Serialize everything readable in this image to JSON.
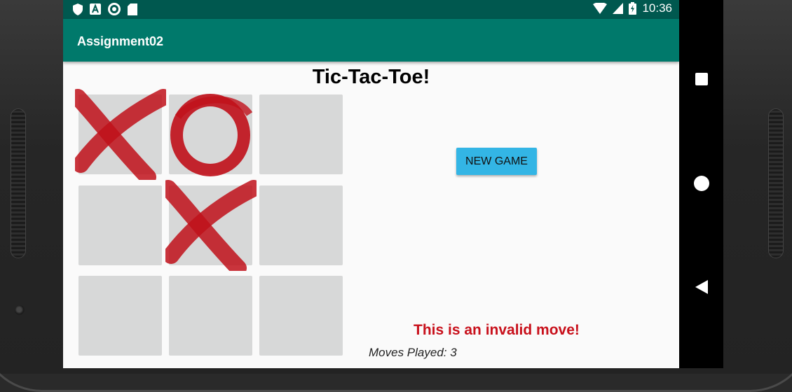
{
  "status_bar": {
    "time": "10:36",
    "left_icons": [
      "shield-icon",
      "a-icon",
      "circle-icon",
      "sd-card-icon"
    ],
    "right_icons": [
      "wifi-icon",
      "signal-icon",
      "battery-icon"
    ]
  },
  "app": {
    "title": "Assignment02"
  },
  "game": {
    "title": "Tic-Tac-Toe!",
    "board": [
      [
        "X",
        "O",
        ""
      ],
      [
        "",
        "X",
        ""
      ],
      [
        "",
        "",
        ""
      ]
    ],
    "mark_color": "#c0101a",
    "new_game_label": "NEW GAME",
    "status_message": "This is an invalid move!",
    "moves_played": "Moves Played: 3"
  },
  "nav_bar": {
    "buttons": [
      "recents-square-icon",
      "home-circle-icon",
      "back-triangle-icon"
    ]
  },
  "colors": {
    "status_bar": "#00584f",
    "app_bar": "#00796b",
    "button": "#33b5e5",
    "error_text": "#c8101b"
  }
}
